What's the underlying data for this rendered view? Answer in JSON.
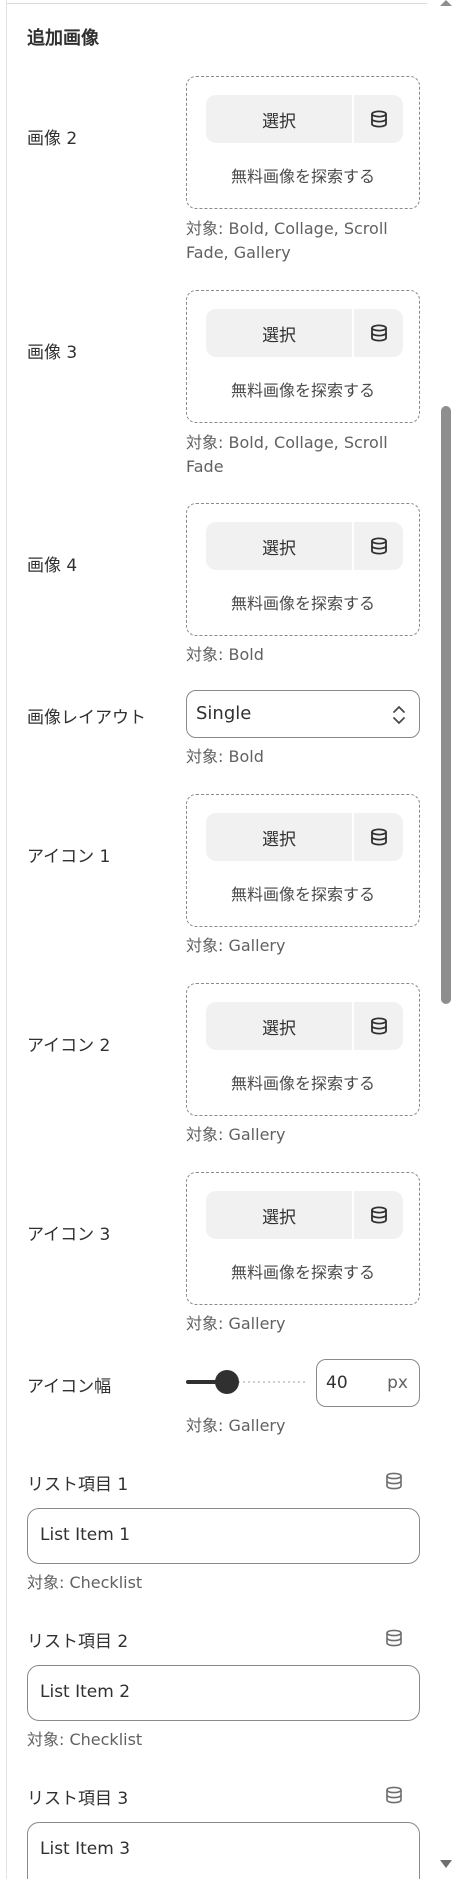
{
  "section": {
    "title": "追加画像"
  },
  "labels": {
    "select": "選択",
    "free_image": "無料画像を探索する"
  },
  "rows": {
    "image2": {
      "label": "画像 2",
      "hint": "対象: Bold, Collage, Scroll Fade, Gallery"
    },
    "image3": {
      "label": "画像 3",
      "hint": "対象: Bold, Collage, Scroll Fade"
    },
    "image4": {
      "label": "画像 4",
      "hint": "対象: Bold"
    },
    "layout": {
      "label": "画像レイアウト",
      "value": "Single",
      "hint": "対象: Bold"
    },
    "icon1": {
      "label": "アイコン 1",
      "hint": "対象: Gallery"
    },
    "icon2": {
      "label": "アイコン 2",
      "hint": "対象: Gallery"
    },
    "icon3": {
      "label": "アイコン 3",
      "hint": "対象: Gallery"
    },
    "icon_width": {
      "label": "アイコン幅",
      "value": "40",
      "unit": "px",
      "slider_value": 40,
      "hint": "対象: Gallery"
    },
    "list1": {
      "label": "リスト項目 1",
      "value": "List Item 1",
      "hint": "対象: Checklist"
    },
    "list2": {
      "label": "リスト項目 2",
      "value": "List Item 2",
      "hint": "対象: Checklist"
    },
    "list3": {
      "label": "リスト項目 3",
      "value": "List Item 3"
    }
  },
  "icons": {
    "dynamic_source": "database-icon",
    "select_chevron": "chevron-up-down-icon"
  },
  "colors": {
    "text": "#303030",
    "hint": "#616161",
    "border": "#8a8a8a",
    "button_bg": "#f1f1f1",
    "scroll_thumb": "#8e8e8e"
  }
}
